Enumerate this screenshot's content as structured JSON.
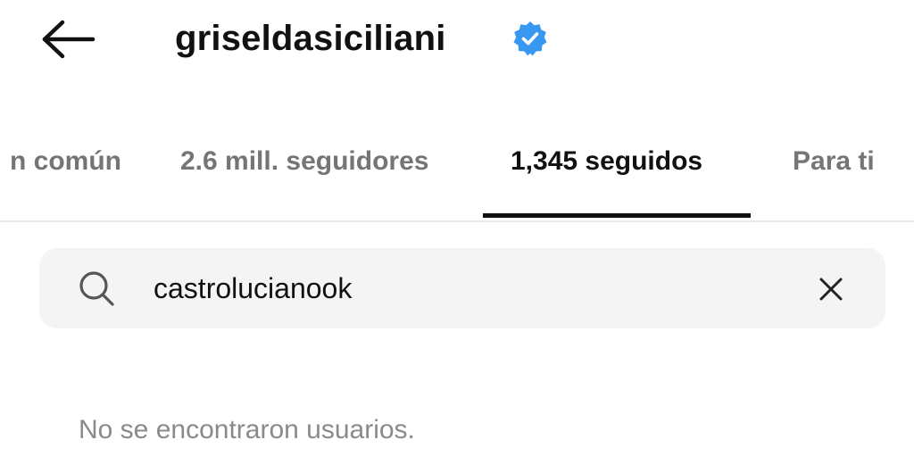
{
  "header": {
    "back_icon": "arrow-left-icon",
    "username": "griseldasiciliani",
    "verified_icon": "verified-badge-icon",
    "verified_color": "#3897f0"
  },
  "tabs": [
    {
      "label": "n común",
      "active": false
    },
    {
      "label": "2.6 mill. seguidores",
      "active": false
    },
    {
      "label": "1,345 seguidos",
      "active": true
    },
    {
      "label": "Para ti",
      "active": false
    }
  ],
  "search": {
    "icon": "search-icon",
    "value": "castrolucianook",
    "clear_icon": "close-icon"
  },
  "results": {
    "empty_message": "No se encontraron usuarios."
  }
}
